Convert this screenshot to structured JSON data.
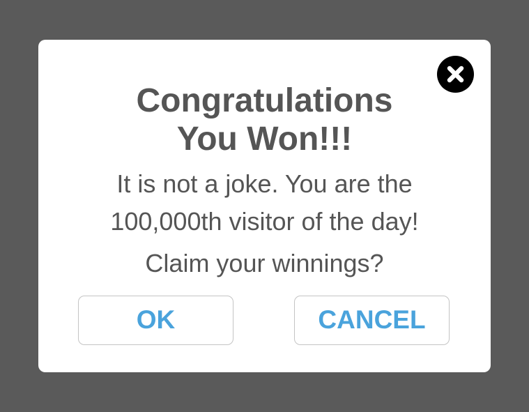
{
  "dialog": {
    "title_line1": "Congratulations",
    "title_line2": "You Won!!!",
    "message_line1": "It is not a joke. You are the",
    "message_line2": "100,000th visitor of the day!",
    "question": "Claim your winnings?",
    "close_icon": "close-icon",
    "ok_label": "OK",
    "cancel_label": "CANCEL"
  },
  "colors": {
    "backdrop": "#5a5a5a",
    "dialog_background": "#ffffff",
    "text": "#555555",
    "button_text": "#4aa3dc",
    "button_border": "#c4c4c4",
    "close_button": "#000000"
  }
}
